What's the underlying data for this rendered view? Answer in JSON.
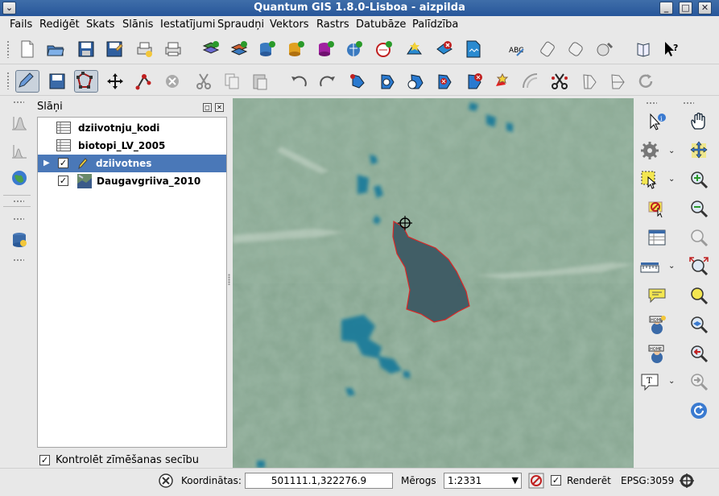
{
  "window": {
    "title": "Quantum GIS 1.8.0-Lisboa - aizpilda"
  },
  "menu": [
    "Fails",
    "Rediģēt",
    "Skats",
    "Slānis",
    "Iestatījumi",
    "Spraudņi",
    "Vektors",
    "Rastrs",
    "Datubāze",
    "Palīdzība"
  ],
  "layers_panel": {
    "title": "Slāņi",
    "layers": [
      {
        "name": "dziivotnju_kodi",
        "type": "table",
        "checked": false,
        "selected": false
      },
      {
        "name": "biotopi_LV_2005",
        "type": "table",
        "checked": false,
        "selected": false
      },
      {
        "name": "dziivotnes",
        "type": "vector",
        "checked": true,
        "selected": true,
        "editing": true
      },
      {
        "name": "Daugavgriiva_2010",
        "type": "raster",
        "checked": true,
        "selected": false
      }
    ],
    "render_order_label": "Kontrolēt zīmēšanas secību",
    "render_order_checked": true
  },
  "status": {
    "coord_label": "Koordinātas:",
    "coord_value": "501111.1,322276.9",
    "scale_label": "Mērogs",
    "scale_value": "1:2331",
    "render_label": "Renderēt",
    "render_checked": true,
    "crs": "EPSG:3059"
  },
  "colors": {
    "title_bar": "#2f5f9f",
    "selection": "#4a78b8",
    "polygon_fill": "#3d5a64",
    "polygon_edge": "#e02020",
    "map_base": "#85a48e",
    "water": "#137a9a"
  }
}
